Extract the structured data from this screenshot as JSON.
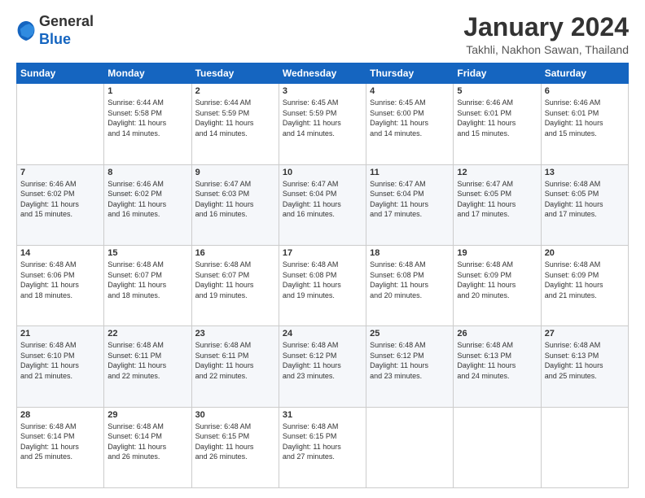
{
  "logo": {
    "general": "General",
    "blue": "Blue"
  },
  "header": {
    "title": "January 2024",
    "subtitle": "Takhli, Nakhon Sawan, Thailand"
  },
  "days_of_week": [
    "Sunday",
    "Monday",
    "Tuesday",
    "Wednesday",
    "Thursday",
    "Friday",
    "Saturday"
  ],
  "weeks": [
    [
      {
        "day": "",
        "info": ""
      },
      {
        "day": "1",
        "info": "Sunrise: 6:44 AM\nSunset: 5:58 PM\nDaylight: 11 hours\nand 14 minutes."
      },
      {
        "day": "2",
        "info": "Sunrise: 6:44 AM\nSunset: 5:59 PM\nDaylight: 11 hours\nand 14 minutes."
      },
      {
        "day": "3",
        "info": "Sunrise: 6:45 AM\nSunset: 5:59 PM\nDaylight: 11 hours\nand 14 minutes."
      },
      {
        "day": "4",
        "info": "Sunrise: 6:45 AM\nSunset: 6:00 PM\nDaylight: 11 hours\nand 14 minutes."
      },
      {
        "day": "5",
        "info": "Sunrise: 6:46 AM\nSunset: 6:01 PM\nDaylight: 11 hours\nand 15 minutes."
      },
      {
        "day": "6",
        "info": "Sunrise: 6:46 AM\nSunset: 6:01 PM\nDaylight: 11 hours\nand 15 minutes."
      }
    ],
    [
      {
        "day": "7",
        "info": "Sunrise: 6:46 AM\nSunset: 6:02 PM\nDaylight: 11 hours\nand 15 minutes."
      },
      {
        "day": "8",
        "info": "Sunrise: 6:46 AM\nSunset: 6:02 PM\nDaylight: 11 hours\nand 16 minutes."
      },
      {
        "day": "9",
        "info": "Sunrise: 6:47 AM\nSunset: 6:03 PM\nDaylight: 11 hours\nand 16 minutes."
      },
      {
        "day": "10",
        "info": "Sunrise: 6:47 AM\nSunset: 6:04 PM\nDaylight: 11 hours\nand 16 minutes."
      },
      {
        "day": "11",
        "info": "Sunrise: 6:47 AM\nSunset: 6:04 PM\nDaylight: 11 hours\nand 17 minutes."
      },
      {
        "day": "12",
        "info": "Sunrise: 6:47 AM\nSunset: 6:05 PM\nDaylight: 11 hours\nand 17 minutes."
      },
      {
        "day": "13",
        "info": "Sunrise: 6:48 AM\nSunset: 6:05 PM\nDaylight: 11 hours\nand 17 minutes."
      }
    ],
    [
      {
        "day": "14",
        "info": "Sunrise: 6:48 AM\nSunset: 6:06 PM\nDaylight: 11 hours\nand 18 minutes."
      },
      {
        "day": "15",
        "info": "Sunrise: 6:48 AM\nSunset: 6:07 PM\nDaylight: 11 hours\nand 18 minutes."
      },
      {
        "day": "16",
        "info": "Sunrise: 6:48 AM\nSunset: 6:07 PM\nDaylight: 11 hours\nand 19 minutes."
      },
      {
        "day": "17",
        "info": "Sunrise: 6:48 AM\nSunset: 6:08 PM\nDaylight: 11 hours\nand 19 minutes."
      },
      {
        "day": "18",
        "info": "Sunrise: 6:48 AM\nSunset: 6:08 PM\nDaylight: 11 hours\nand 20 minutes."
      },
      {
        "day": "19",
        "info": "Sunrise: 6:48 AM\nSunset: 6:09 PM\nDaylight: 11 hours\nand 20 minutes."
      },
      {
        "day": "20",
        "info": "Sunrise: 6:48 AM\nSunset: 6:09 PM\nDaylight: 11 hours\nand 21 minutes."
      }
    ],
    [
      {
        "day": "21",
        "info": "Sunrise: 6:48 AM\nSunset: 6:10 PM\nDaylight: 11 hours\nand 21 minutes."
      },
      {
        "day": "22",
        "info": "Sunrise: 6:48 AM\nSunset: 6:11 PM\nDaylight: 11 hours\nand 22 minutes."
      },
      {
        "day": "23",
        "info": "Sunrise: 6:48 AM\nSunset: 6:11 PM\nDaylight: 11 hours\nand 22 minutes."
      },
      {
        "day": "24",
        "info": "Sunrise: 6:48 AM\nSunset: 6:12 PM\nDaylight: 11 hours\nand 23 minutes."
      },
      {
        "day": "25",
        "info": "Sunrise: 6:48 AM\nSunset: 6:12 PM\nDaylight: 11 hours\nand 23 minutes."
      },
      {
        "day": "26",
        "info": "Sunrise: 6:48 AM\nSunset: 6:13 PM\nDaylight: 11 hours\nand 24 minutes."
      },
      {
        "day": "27",
        "info": "Sunrise: 6:48 AM\nSunset: 6:13 PM\nDaylight: 11 hours\nand 25 minutes."
      }
    ],
    [
      {
        "day": "28",
        "info": "Sunrise: 6:48 AM\nSunset: 6:14 PM\nDaylight: 11 hours\nand 25 minutes."
      },
      {
        "day": "29",
        "info": "Sunrise: 6:48 AM\nSunset: 6:14 PM\nDaylight: 11 hours\nand 26 minutes."
      },
      {
        "day": "30",
        "info": "Sunrise: 6:48 AM\nSunset: 6:15 PM\nDaylight: 11 hours\nand 26 minutes."
      },
      {
        "day": "31",
        "info": "Sunrise: 6:48 AM\nSunset: 6:15 PM\nDaylight: 11 hours\nand 27 minutes."
      },
      {
        "day": "",
        "info": ""
      },
      {
        "day": "",
        "info": ""
      },
      {
        "day": "",
        "info": ""
      }
    ]
  ]
}
